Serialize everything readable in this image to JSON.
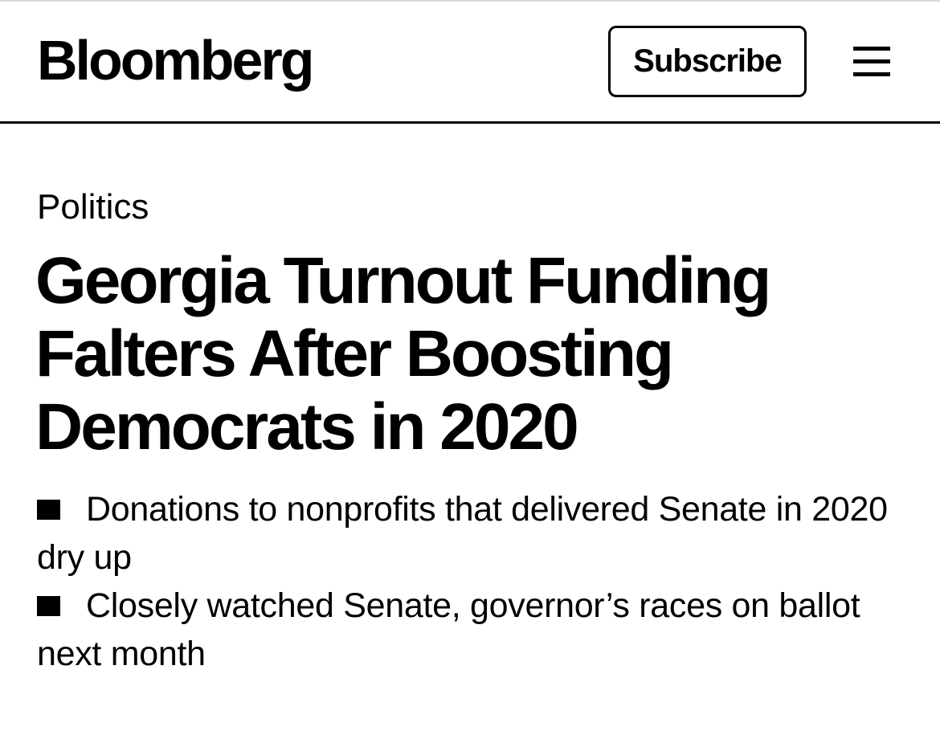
{
  "header": {
    "logo_text": "Bloomberg",
    "subscribe_label": "Subscribe",
    "menu_icon": "hamburger-menu-icon"
  },
  "article": {
    "category": "Politics",
    "headline": "Georgia Turnout Funding Falters After Boosting Democrats in 2020",
    "bullets": [
      "Donations to nonprofits that delivered Senate in 2020 dry up",
      "Closely watched Senate, governor’s races on ballot next month"
    ]
  },
  "colors": {
    "text": "#000000",
    "background": "#ffffff",
    "divider": "#000000"
  }
}
